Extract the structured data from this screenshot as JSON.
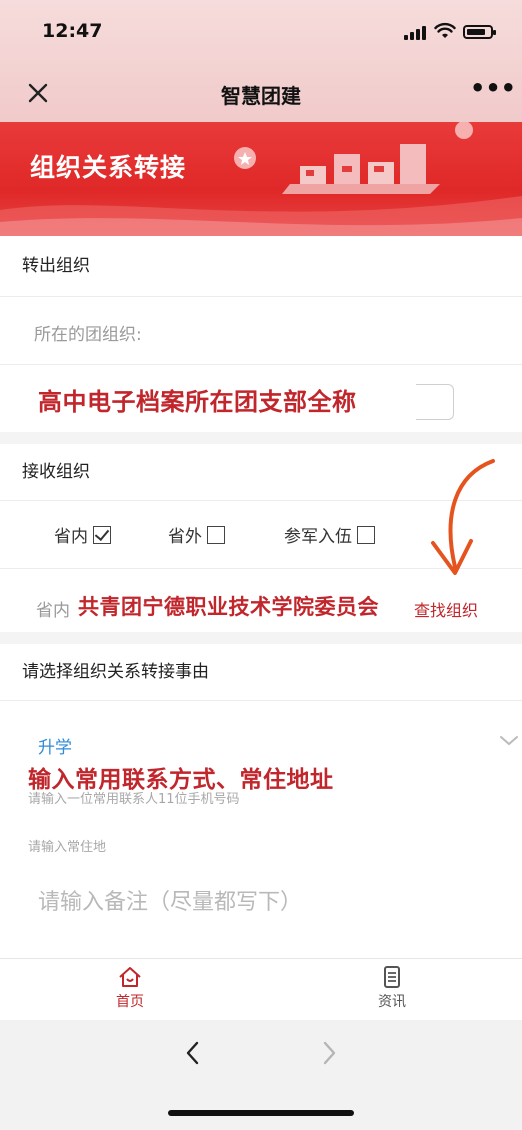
{
  "status_bar": {
    "time": "12:47"
  },
  "nav": {
    "title": "智慧团建",
    "more": "•••"
  },
  "banner": {
    "title": "组织关系转接"
  },
  "transfer_out": {
    "heading": "转出组织",
    "field_label": "所在的团组织:",
    "annotation": "高中电子档案所在团支部全称"
  },
  "receive": {
    "heading": "接收组织",
    "options": [
      {
        "label": "省内",
        "checked": true
      },
      {
        "label": "省外",
        "checked": false
      },
      {
        "label": "参军入伍",
        "checked": false
      }
    ],
    "prefix": "省内",
    "org_name": "共青团宁德职业技术学院委员会",
    "find_button": "查找组织"
  },
  "reason": {
    "heading": "请选择组织关系转接事由",
    "selected": "升学",
    "annotation": "输入常用联系方式、常住地址",
    "phone_placeholder": "请输入一位常用联系人11位手机号码",
    "address_placeholder": "请输入常住地",
    "remark_placeholder": "请输入备注（尽量都写下）"
  },
  "tabbar": {
    "items": [
      {
        "label": "首页",
        "icon": "home-icon",
        "active": true
      },
      {
        "label": "资讯",
        "icon": "news-icon",
        "active": false
      }
    ]
  },
  "colors": {
    "brand_red": "#e02828",
    "annotation_red": "#c0262b",
    "link_blue": "#2f8bd8",
    "arrow_orange": "#e5541f"
  }
}
